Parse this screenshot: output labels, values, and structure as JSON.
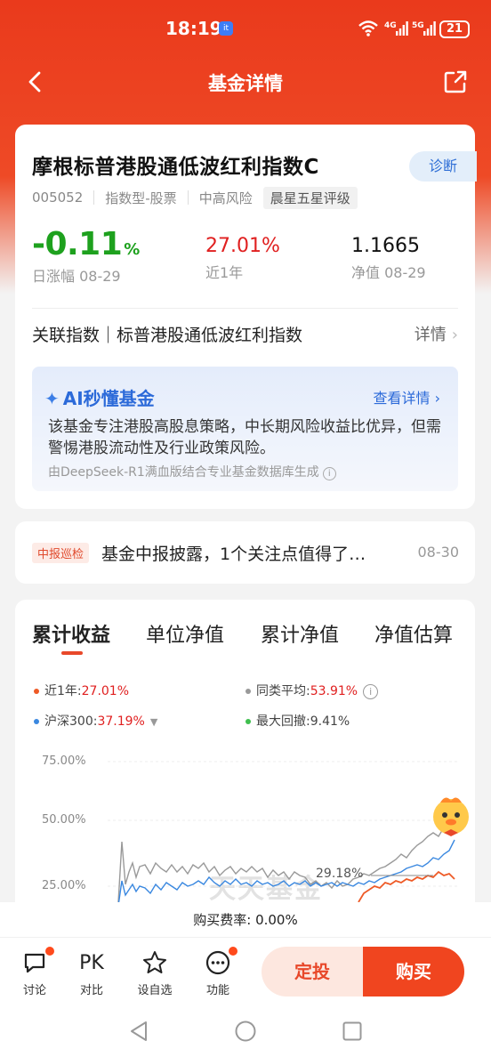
{
  "status_bar": {
    "time": "18:19",
    "app_badge": "it",
    "net1": "4G",
    "net2": "5G",
    "battery": "21"
  },
  "nav": {
    "title": "基金详情"
  },
  "fund": {
    "name": "摩根标普港股通低波红利指数C",
    "diagnose": "诊断",
    "code": "005052",
    "type": "指数型-股票",
    "risk": "中高风险",
    "rating": "晨星五星评级",
    "daily_change": "-0.11",
    "daily_change_unit": "%",
    "daily_change_label": "日涨幅 08-29",
    "year_return": "27.01%",
    "year_return_label": "近1年",
    "nav_value": "1.1665",
    "nav_label": "净值 08-29",
    "index_row": "关联指数｜标普港股通低波红利指数",
    "index_detail": "详情"
  },
  "ai": {
    "title": "AI秒懂基金",
    "more": "查看详情 ›",
    "text": "该基金专注港股高股息策略，中长期风险收益比优异，但需警惕港股流动性及行业政策风险。",
    "source": "由DeepSeek-R1满血版结合专业基金数据库生成"
  },
  "report": {
    "tag": "中报巡检",
    "text": "基金中报披露，1个关注点值得了…",
    "date": "08-30"
  },
  "tabs": [
    "累计收益",
    "单位净值",
    "累计净值",
    "净值估算"
  ],
  "legend": {
    "year_label": "近1年:",
    "year_value": "27.01%",
    "peer_label": "同类平均:",
    "peer_value": "53.91%",
    "hs300_label": "沪深300:",
    "hs300_value": "37.19%",
    "drawdown_label": "最大回撤:",
    "drawdown_value": "9.41%"
  },
  "chart": {
    "y_labels": [
      "75.00%",
      "50.00%",
      "25.00%"
    ],
    "marker_label": "29.18%",
    "watermark": "天天基金",
    "colors": {
      "fund": "#ee5a26",
      "peer": "#999999",
      "hs300": "#3a88e0",
      "drawdown": "#3fbf4f"
    }
  },
  "fee": {
    "text": "购买费率: 0.00%"
  },
  "bottom": {
    "discuss": "讨论",
    "pk_icon": "PK",
    "compare": "对比",
    "watch": "设自选",
    "func": "功能",
    "dingtou": "定投",
    "buy": "购买"
  },
  "icons": [
    "back-icon",
    "share-icon",
    "wifi-icon",
    "sparkle-icon",
    "chevron-right-icon",
    "info-icon",
    "chat-icon",
    "star-icon",
    "more-icon"
  ],
  "accent": "#ea3a1c"
}
